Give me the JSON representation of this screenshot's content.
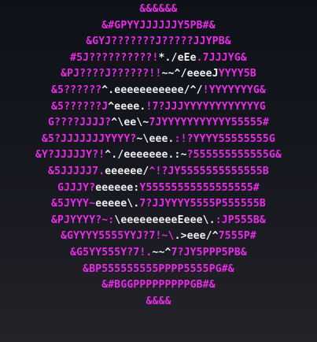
{
  "colors": {
    "primary": "#ea2bea",
    "light": "#f0eef0",
    "background": "#14161d"
  },
  "art": [
    [
      [
        "p",
        "&&&&&&"
      ]
    ],
    [
      [
        "p",
        "&#GPYYJJJJJJY5PB#&"
      ]
    ],
    [
      [
        "p",
        "&GYJ???????J?????JJYPB&"
      ]
    ],
    [
      [
        "p",
        "#5J??????????!"
      ],
      [
        "w",
        "*./eEe"
      ],
      [
        "p",
        ".7JJJYG&"
      ]
    ],
    [
      [
        "p",
        "&PJ????J??????!!"
      ],
      [
        "w",
        "~~^/eeeeJ"
      ],
      [
        "p",
        "YYYY5B"
      ]
    ],
    [
      [
        "p",
        "&5??????"
      ],
      [
        "w",
        "^.eeeeeeeeeee/^/"
      ],
      [
        "p",
        "!YYYYYYYG&"
      ]
    ],
    [
      [
        "p",
        "&5??????J"
      ],
      [
        "w",
        "^eeee."
      ],
      [
        "p",
        "!7?JJJYYYYYYYYYYYYG"
      ]
    ],
    [
      [
        "p",
        "G????JJJJ?"
      ],
      [
        "w",
        "^\\ee\\~"
      ],
      [
        "p",
        "7JYYYYYYYYYYY55555#"
      ]
    ],
    [
      [
        "p",
        "&5?JJJJJJJYYYY?"
      ],
      [
        "w",
        "~\\eee."
      ],
      [
        "p",
        ":!?YYYY55555555G"
      ]
    ],
    [
      [
        "p",
        "&Y?JJJJJY?!"
      ],
      [
        "w",
        "^./eeeeeee.:~"
      ],
      [
        "p",
        "?555555555555G&"
      ]
    ],
    [
      [
        "p",
        "&5JJJJJ7."
      ],
      [
        "w",
        "eeeeee/"
      ],
      [
        "p",
        "^!?JY5555555555555B"
      ]
    ],
    [
      [
        "p",
        "GJJJY?"
      ],
      [
        "w",
        "eeeeee:"
      ],
      [
        "p",
        "Y55555555555555555#"
      ]
    ],
    [
      [
        "p",
        "&5JYYY~"
      ],
      [
        "w",
        "eeeee\\."
      ],
      [
        "p",
        "7?JJYYYY5555P555555B"
      ]
    ],
    [
      [
        "p",
        "&PJYYYY?~:"
      ],
      [
        "w",
        "\\eeeeeeeeeEeee\\."
      ],
      [
        "p",
        ":JP555B&"
      ]
    ],
    [
      [
        "p",
        "&GYYYY5555YYJ?7!~\\"
      ],
      [
        "w",
        ".>eee/^"
      ],
      [
        "p",
        "7555P#"
      ]
    ],
    [
      [
        "p",
        "&G5YY555Y?7!."
      ],
      [
        "w",
        "~~^"
      ],
      [
        "p",
        "7?JY5PPP5PB&"
      ]
    ],
    [
      [
        "p",
        "&BP555555555PPPP5555PG#&"
      ]
    ],
    [
      [
        "p",
        "&#BGGPPPPPPPPPGB#&"
      ]
    ],
    [
      [
        "p",
        "&&&&"
      ]
    ]
  ]
}
